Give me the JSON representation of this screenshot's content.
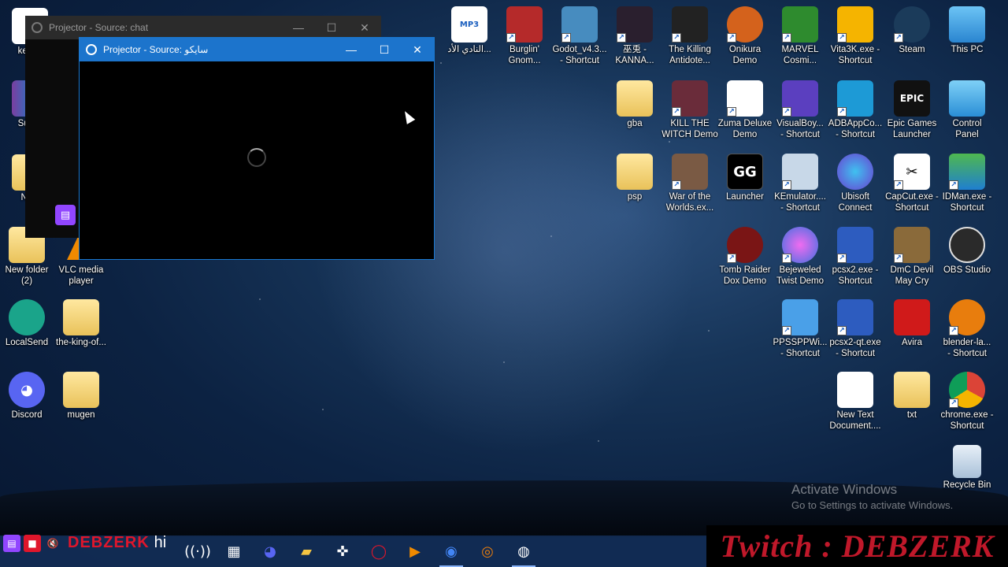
{
  "colors": {
    "accent": "#1c74cc",
    "twitch": "#9146ff",
    "brand_red": "#e0162b"
  },
  "windows": {
    "chat": {
      "title": "Projector - Source: chat",
      "minimize": "—",
      "maximize": "☐",
      "close": "✕"
    },
    "main": {
      "title": "Projector - Source: سايكو",
      "minimize": "—",
      "maximize": "☐",
      "close": "✕"
    }
  },
  "left_icons": [
    {
      "label": "kemul",
      "icon": "file-icon"
    },
    {
      "label": "Super",
      "icon": "winrar-icon"
    },
    {
      "label": "New",
      "icon": "folder-icon"
    },
    {
      "label": "New folder\n(2)",
      "icon": "folder-icon"
    },
    {
      "label": "VLC media\nplayer",
      "icon": "vlc-icon"
    },
    {
      "label": "LocalSend",
      "icon": "localsend-icon"
    },
    {
      "label": "the-king-of...",
      "icon": "folder-icon"
    },
    {
      "label": "Discord",
      "icon": "discord-icon"
    },
    {
      "label": "mugen",
      "icon": "folder-icon"
    }
  ],
  "right_icons": [
    {
      "label": "النادي الأد...",
      "icon": "mp3-icon",
      "badge": "MP3"
    },
    {
      "label": "Burglin'\nGnom...",
      "icon": "game-icon"
    },
    {
      "label": "Godot_v4.3...\n- Shortcut",
      "icon": "godot-icon"
    },
    {
      "label": "巫兎 -\nKANNA...",
      "icon": "game-icon"
    },
    {
      "label": "The Killing\nAntidote...",
      "icon": "game-icon"
    },
    {
      "label": "Onikura\nDemo",
      "icon": "game-icon"
    },
    {
      "label": "MARVEL\nCosmi...",
      "icon": "game-icon"
    },
    {
      "label": "Vita3K.exe -\nShortcut",
      "icon": "vita3k-icon"
    },
    {
      "label": "Steam",
      "icon": "steam-icon"
    },
    {
      "label": "This PC",
      "icon": "computer-icon"
    },
    {
      "label": "gba",
      "icon": "folder-icon"
    },
    {
      "label": "KILL THE\nWITCH Demo",
      "icon": "game-icon"
    },
    {
      "label": "Zuma Deluxe\nDemo",
      "icon": "doc-icon"
    },
    {
      "label": "VisualBoy...\n- Shortcut",
      "icon": "gameboy-icon"
    },
    {
      "label": "ADBAppCo...\n- Shortcut",
      "icon": "android-icon"
    },
    {
      "label": "Epic Games\nLauncher",
      "icon": "epic-icon",
      "badge": "EPIC"
    },
    {
      "label": "Control\nPanel",
      "icon": "control-panel-icon"
    },
    {
      "label": "psp",
      "icon": "folder-icon"
    },
    {
      "label": "War of the\nWorlds.ex...",
      "icon": "game-icon"
    },
    {
      "label": "Launcher",
      "icon": "launcher-icon",
      "badge": "GG"
    },
    {
      "label": "KEmulator....\n- Shortcut",
      "icon": "phone-icon"
    },
    {
      "label": "Ubisoft\nConnect",
      "icon": "ubisoft-icon"
    },
    {
      "label": "CapCut.exe -\nShortcut",
      "icon": "capcut-icon"
    },
    {
      "label": "IDMan.exe -\nShortcut",
      "icon": "idm-icon"
    },
    {
      "label": "Tomb Raider\nDox Demo",
      "icon": "game-icon"
    },
    {
      "label": "Bejeweled\nTwist Demo",
      "icon": "gem-icon"
    },
    {
      "label": "pcsx2.exe -\nShortcut",
      "icon": "pcsx2-icon"
    },
    {
      "label": "DmC Devil\nMay Cry",
      "icon": "game-icon"
    },
    {
      "label": "OBS Studio",
      "icon": "obs-icon"
    },
    {
      "label": "PPSSPPWi...\n- Shortcut",
      "icon": "ppsspp-icon"
    },
    {
      "label": "pcsx2-qt.exe\n- Shortcut",
      "icon": "pcsx2-icon"
    },
    {
      "label": "Avira",
      "icon": "avira-icon"
    },
    {
      "label": "blender-la...\n- Shortcut",
      "icon": "blender-icon"
    },
    {
      "label": "New Text\nDocument....",
      "icon": "text-doc-icon"
    },
    {
      "label": "txt",
      "icon": "folder-icon"
    },
    {
      "label": "chrome.exe -\nShortcut",
      "icon": "chrome-icon"
    },
    {
      "label": "Recycle Bin",
      "icon": "recycle-bin-icon"
    }
  ],
  "watermark": {
    "line1": "Activate Windows",
    "line2": "Go to Settings to activate Windows."
  },
  "overlay": {
    "channel_small": "DEBZERK",
    "greeting": "hi",
    "banner": "Twitch : DEBZERK"
  },
  "taskbar": {
    "items": [
      {
        "icon": "network-icon"
      },
      {
        "icon": "task-manager-icon"
      },
      {
        "icon": "discord-icon"
      },
      {
        "icon": "file-explorer-icon"
      },
      {
        "icon": "gamepad-icon"
      },
      {
        "icon": "opera-icon"
      },
      {
        "icon": "media-player-icon"
      },
      {
        "icon": "chrome-icon"
      },
      {
        "icon": "blender-icon"
      },
      {
        "icon": "obs-icon",
        "active": true
      }
    ]
  }
}
